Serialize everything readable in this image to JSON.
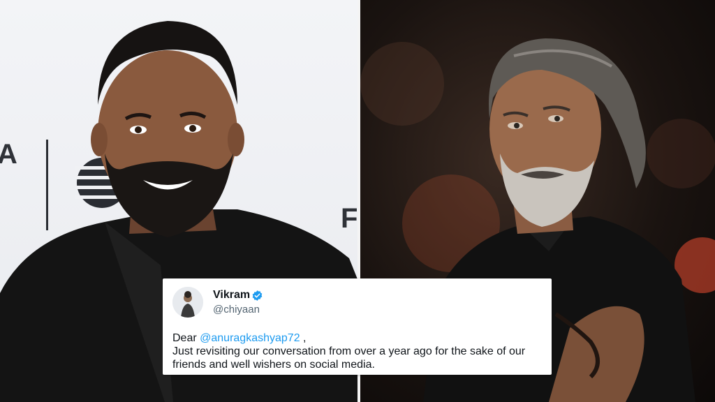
{
  "photos": {
    "left_backdrop_letters": [
      "A",
      "F"
    ],
    "left_subject": "anurag-kashyap-photo",
    "right_subject": "vikram-photo"
  },
  "tweet": {
    "author_name": "Vikram",
    "verified": true,
    "handle": "@chiyaan",
    "greeting": "Dear",
    "mention": "@anuragkashyap72",
    "greeting_suffix": " ,",
    "body_line_1": "Just revisiting our conversation from over a year ago for the sake of our",
    "body_line_2": "friends and well wishers on social media.",
    "colors": {
      "mention": "#1d9bf0",
      "text": "#0f1419",
      "handle": "#536471",
      "badge": "#1d9bf0"
    }
  }
}
